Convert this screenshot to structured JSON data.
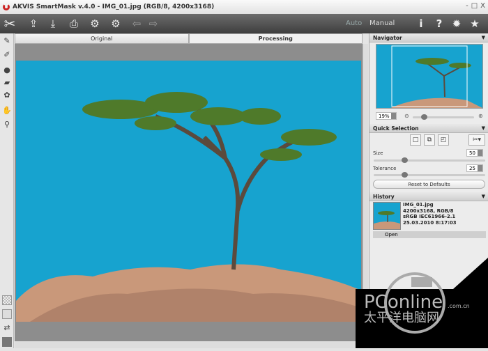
{
  "window": {
    "title": "AKVIS SmartMask v.4.0 - IMG_01.jpg (RGB/8, 4200x3168)",
    "controls": [
      "-",
      "□",
      "X"
    ]
  },
  "toolbar": {
    "icons": [
      "scissors-logo-icon",
      "open-icon",
      "save-icon",
      "print-icon",
      "import-settings-icon",
      "export-settings-icon",
      "undo-arrow-icon",
      "redo-arrow-icon"
    ],
    "mode_auto": "Auto",
    "mode_manual": "Manual",
    "right_icons": [
      "info-icon",
      "help-icon",
      "settings-icon",
      "star-icon"
    ]
  },
  "tabs": [
    {
      "label": "Original"
    },
    {
      "label": "Processing"
    }
  ],
  "navigator": {
    "title": "Navigator",
    "zoom": "19%"
  },
  "quick_selection": {
    "title": "Quick Selection",
    "size_label": "Size",
    "size_value": "50",
    "size_fraction": 0.28,
    "tolerance_label": "Tolerance",
    "tolerance_value": "25",
    "tolerance_fraction": 0.28,
    "reset_label": "Reset to Defaults"
  },
  "history": {
    "title": "History",
    "info": [
      "IMG_01.jpg",
      "4200x3168, RGB/8",
      "sRGB IEC61966-2.1",
      "25.03.2010 8:17:03"
    ],
    "open_label": "Open"
  },
  "watermark": {
    "brand": "PConline",
    "domain": ".com.cn",
    "chinese": "太平洋电脑网"
  },
  "colors": {
    "sky": "#17a3cf",
    "toolbar": "#4a4a4a"
  }
}
